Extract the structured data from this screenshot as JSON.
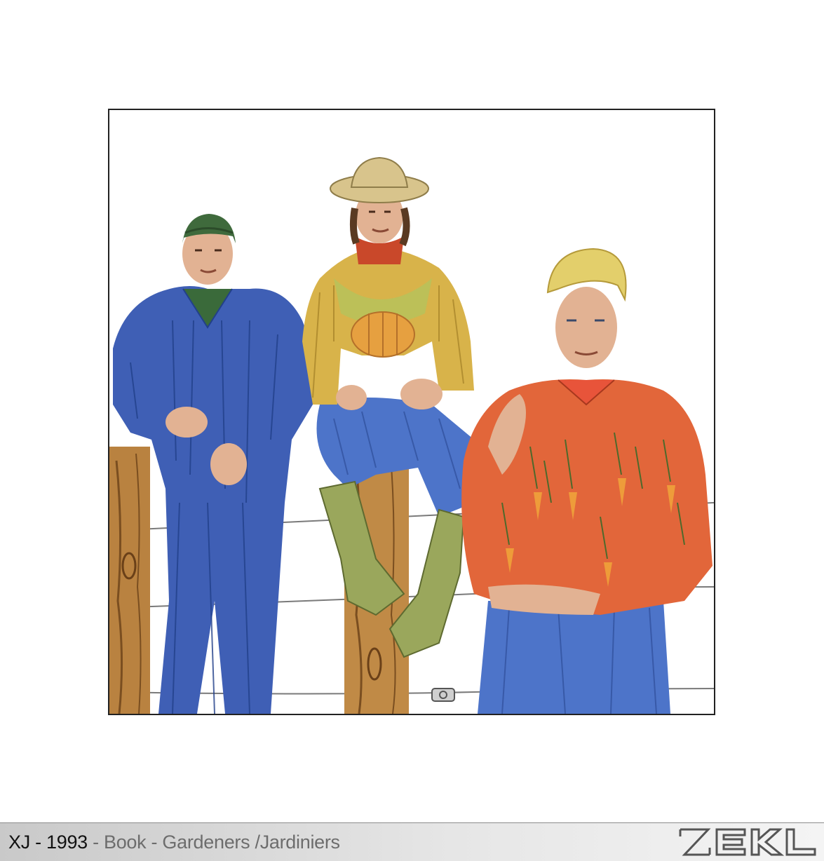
{
  "caption": {
    "code": "XJ",
    "sep1": " - ",
    "year": "1993",
    "rest": " - Book - Gardeners /Jardiniers"
  },
  "logo": {
    "lettering": "ZEKL"
  },
  "colors": {
    "tile_line": "#a8a8a8",
    "frame_border": "#222222",
    "caption_text": "#111111",
    "caption_dim": "#6d6d6d",
    "coverall_blue": "#3f5fb5",
    "jeans_blue": "#4d74c9",
    "shirt_yellow": "#d8b34a",
    "shirt_orange": "#e2663a",
    "boot_green": "#9aa75c",
    "post_brown": "#b98240",
    "hat_straw": "#d8c48c",
    "beanie_green": "#3f6a3c",
    "hair_blond": "#e3cf6b",
    "skin": "#e2b293"
  }
}
